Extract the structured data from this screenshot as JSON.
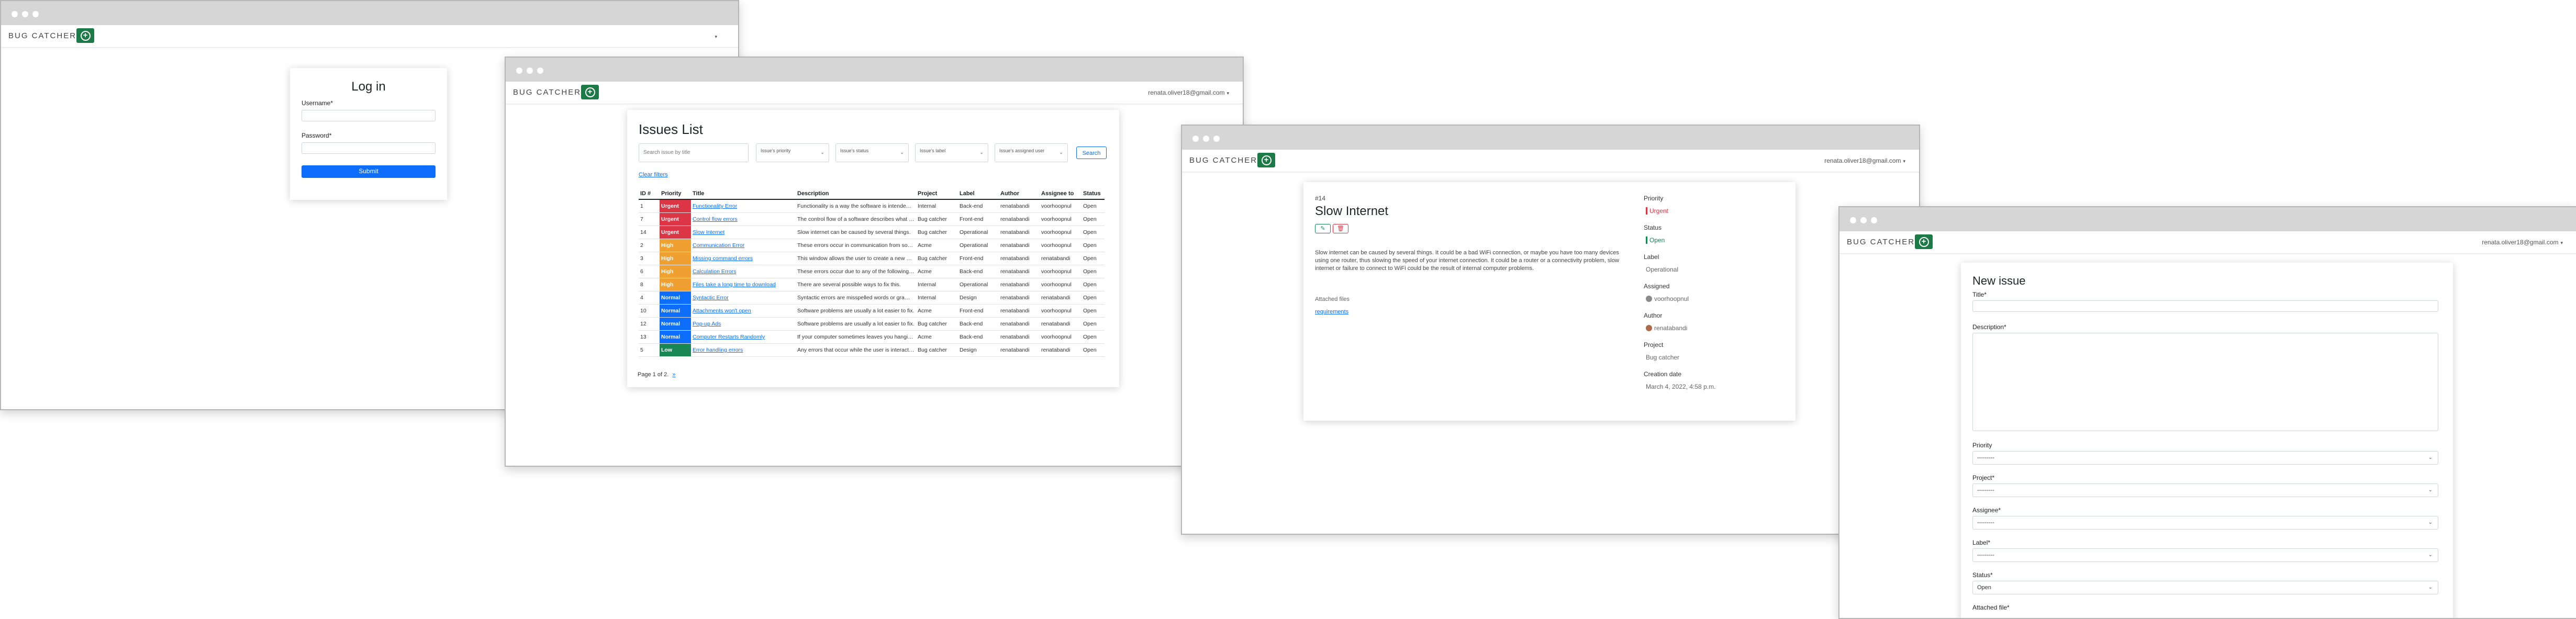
{
  "brand": "BUG CATCHER",
  "login": {
    "title": "Log in",
    "username_label": "Username*",
    "password_label": "Password*",
    "submit_label": "Submit"
  },
  "issues_list": {
    "user_email": "renata.oliver18@gmail.com",
    "title": "Issues List",
    "search_placeholder": "Search issue by title",
    "filters": [
      "Issue's priority",
      "Issue's status",
      "Issue's label",
      "Issue's assigned user"
    ],
    "search_button": "Search",
    "clear_filters": "Clear filters",
    "columns": [
      "ID #",
      "Priority",
      "Title",
      "Description",
      "Project",
      "Label",
      "Author",
      "Assignee to",
      "Status"
    ],
    "rows": [
      {
        "id": "1",
        "priority": "Urgent",
        "level": "urgent",
        "title": "Functionality Error",
        "description": "Functionality is a way the software is intended to behave.",
        "project": "Internal",
        "label": "Back-end",
        "author": "renatabandi",
        "assignee": "voorhoopnul",
        "status": "Open"
      },
      {
        "id": "7",
        "priority": "Urgent",
        "level": "urgent",
        "title": "Control flow errors",
        "description": "The control flow of a software describes what it will do next.",
        "project": "Bug catcher",
        "label": "Front-end",
        "author": "renatabandi",
        "assignee": "voorhoopnul",
        "status": "Open"
      },
      {
        "id": "14",
        "priority": "Urgent",
        "level": "urgent",
        "title": "Slow Internet",
        "description": "Slow internet can be caused by several things.",
        "project": "Bug catcher",
        "label": "Operational",
        "author": "renatabandi",
        "assignee": "voorhoopnul",
        "status": "Open"
      },
      {
        "id": "2",
        "priority": "High",
        "level": "high",
        "title": "Communication Error",
        "description": "These errors occur in communication from software to user.",
        "project": "Acme",
        "label": "Operational",
        "author": "renatabandi",
        "assignee": "voorhoopnul",
        "status": "Open"
      },
      {
        "id": "3",
        "priority": "High",
        "level": "high",
        "title": "Missing command errors",
        "description": "This window allows the user to create a new account.",
        "project": "Bug catcher",
        "label": "Front-end",
        "author": "renatabandi",
        "assignee": "renatabandi",
        "status": "Open"
      },
      {
        "id": "6",
        "priority": "High",
        "level": "high",
        "title": "Calculation Errors",
        "description": "These errors occur due to any of the following reasons.",
        "project": "Acme",
        "label": "Back-end",
        "author": "renatabandi",
        "assignee": "voorhoopnul",
        "status": "Open"
      },
      {
        "id": "8",
        "priority": "High",
        "level": "high",
        "title": "Files take a long time to download",
        "description": "There are several possible ways to fix this.",
        "project": "Internal",
        "label": "Operational",
        "author": "renatabandi",
        "assignee": "voorhoopnul",
        "status": "Open"
      },
      {
        "id": "4",
        "priority": "Normal",
        "level": "normal",
        "title": "Syntactic Error",
        "description": "Syntactic errors are misspelled words or grammatical errors.",
        "project": "Internal",
        "label": "Design",
        "author": "renatabandi",
        "assignee": "renatabandi",
        "status": "Open"
      },
      {
        "id": "10",
        "priority": "Normal",
        "level": "normal",
        "title": "Attachments won't open",
        "description": "Software problems are usually a lot easier to fix.",
        "project": "Acme",
        "label": "Front-end",
        "author": "renatabandi",
        "assignee": "voorhoopnul",
        "status": "Open"
      },
      {
        "id": "12",
        "priority": "Normal",
        "level": "normal",
        "title": "Pop-up Ads",
        "description": "Software problems are usually a lot easier to fix.",
        "project": "Bug catcher",
        "label": "Back-end",
        "author": "renatabandi",
        "assignee": "renatabandi",
        "status": "Open"
      },
      {
        "id": "13",
        "priority": "Normal",
        "level": "normal",
        "title": "Computer Restarts Randomly",
        "description": "If your computer sometimes leaves you hanging.",
        "project": "Acme",
        "label": "Back-end",
        "author": "renatabandi",
        "assignee": "voorhoopnul",
        "status": "Open"
      },
      {
        "id": "5",
        "priority": "Low",
        "level": "low",
        "title": "Error handling errors",
        "description": "Any errors that occur while the user is interacting.",
        "project": "Bug catcher",
        "label": "Design",
        "author": "renatabandi",
        "assignee": "renatabandi",
        "status": "Open"
      }
    ],
    "pagination": "Page 1 of 2.",
    "next_link": "»"
  },
  "issue_detail": {
    "user_email": "renata.oliver18@gmail.com",
    "issue_number": "#14",
    "title": "Slow Internet",
    "description": "Slow internet can be caused by several things. It could be a bad WiFi connection, or maybe you have too many devices using one router, thus slowing the speed of your internet connection. It could be a router or a connectivity problem, slow internet or failure to connect to WiFi could be the result of internal computer problems.",
    "attached_files_label": "Attached files",
    "attachment": "requirements",
    "priority_label": "Priority",
    "priority_value": "Urgent",
    "status_label": "Status",
    "status_value": "Open",
    "label_label": "Label",
    "label_value": "Operational",
    "assigned_label": "Assigned",
    "assigned_value": "voorhoopnul",
    "author_label": "Author",
    "author_value": "renatabandi",
    "project_label": "Project",
    "project_value": "Bug catcher",
    "creation_label": "Creation date",
    "creation_value": "March 4, 2022, 4:58 p.m."
  },
  "new_issue": {
    "user_email": "renata.oliver18@gmail.com",
    "title": "New issue",
    "title_label": "Title*",
    "description_label": "Description*",
    "priority_label": "Priority",
    "priority_value": "---------",
    "project_label": "Project*",
    "project_value": "---------",
    "assignee_label": "Assignee*",
    "assignee_value": "---------",
    "label_label": "Label*",
    "label_value": "---------",
    "status_label": "Status*",
    "status_value": "Open",
    "attached_label": "Attached file*"
  },
  "colors": {
    "brand_green": "#1b7a46",
    "primary": "#0d6efd",
    "urgent": "#dc3545",
    "high": "#f0a030",
    "normal": "#0d6efd",
    "low": "#198754"
  }
}
